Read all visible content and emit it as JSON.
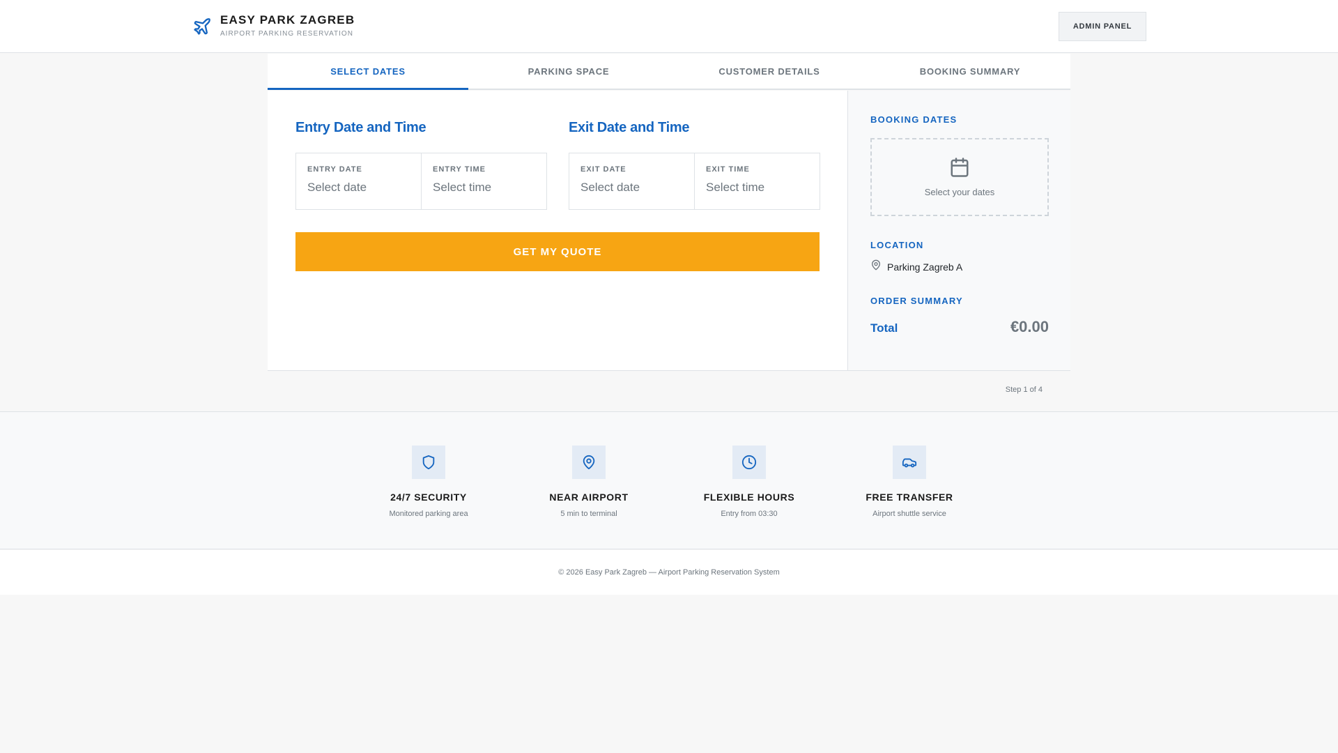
{
  "header": {
    "title": "EASY PARK ZAGREB",
    "subtitle": "AIRPORT PARKING RESERVATION",
    "admin_label": "ADMIN PANEL",
    "icon": "plane-icon"
  },
  "tabs": [
    {
      "label": "SELECT DATES",
      "active": true
    },
    {
      "label": "PARKING SPACE",
      "active": false
    },
    {
      "label": "CUSTOMER DETAILS",
      "active": false
    },
    {
      "label": "BOOKING SUMMARY",
      "active": false
    }
  ],
  "entry": {
    "title": "Entry Date and Time",
    "date_label": "ENTRY DATE",
    "date_placeholder": "Select date",
    "time_label": "ENTRY TIME",
    "time_placeholder": "Select time"
  },
  "exit": {
    "title": "Exit Date and Time",
    "date_label": "EXIT DATE",
    "date_placeholder": "Select date",
    "time_label": "EXIT TIME",
    "time_placeholder": "Select time"
  },
  "quote_button": "GET MY QUOTE",
  "sidebar": {
    "booking_dates_heading": "BOOKING DATES",
    "select_dates_text": "Select your dates",
    "location_heading": "LOCATION",
    "location_value": "Parking Zagreb A",
    "order_summary_heading": "ORDER SUMMARY",
    "total_label": "Total",
    "total_value": "€0.00"
  },
  "step_text": "Step 1 of 4",
  "features": [
    {
      "title": "24/7 SECURITY",
      "desc": "Monitored parking area",
      "icon": "shield-icon"
    },
    {
      "title": "NEAR AIRPORT",
      "desc": "5 min to terminal",
      "icon": "location-pin-icon"
    },
    {
      "title": "FLEXIBLE HOURS",
      "desc": "Entry from 03:30",
      "icon": "clock-icon"
    },
    {
      "title": "FREE TRANSFER",
      "desc": "Airport shuttle service",
      "icon": "car-icon"
    }
  ],
  "footer": "© 2026 Easy Park Zagreb — Airport Parking Reservation System",
  "colors": {
    "accent": "#1565c0",
    "cta": "#f7a513"
  }
}
